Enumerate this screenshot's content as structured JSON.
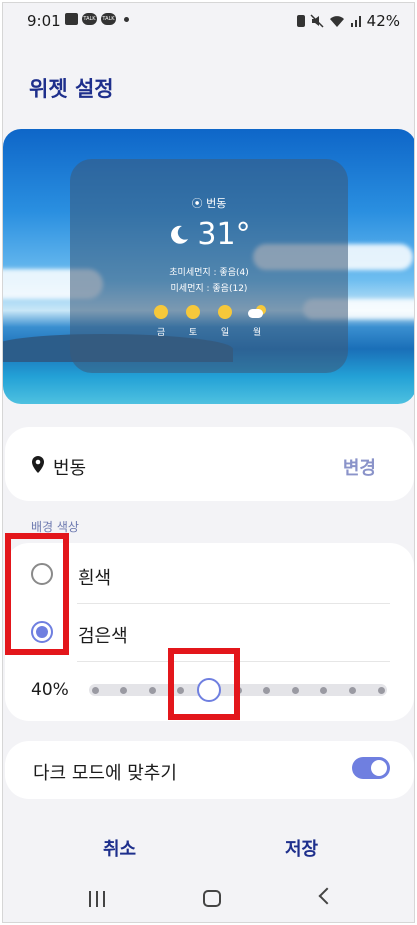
{
  "status_bar": {
    "time": "9:01",
    "notification_icons": [
      "image-icon",
      "talk-icon",
      "talk-icon",
      "dot-icon"
    ],
    "talk_label": "TALK",
    "battery": "42%",
    "status_icons": [
      "battery-saver-icon",
      "mute-icon",
      "wifi-icon",
      "signal-icon"
    ]
  },
  "page": {
    "title": "위젯 설정"
  },
  "preview": {
    "location": "번동",
    "temperature": "31°",
    "weather_icon": "moon-icon",
    "fine_dust": "초미세먼지 : 좋음(4)",
    "dust": "미세먼지 : 좋음(12)",
    "forecast": [
      {
        "day": "금",
        "icon": "sun-icon"
      },
      {
        "day": "토",
        "icon": "sun-icon"
      },
      {
        "day": "일",
        "icon": "sun-icon"
      },
      {
        "day": "월",
        "icon": "cloud-sun-icon"
      }
    ]
  },
  "location_card": {
    "name": "번동",
    "change_label": "변경"
  },
  "background": {
    "section_label": "배경 색상",
    "options": [
      {
        "label": "흰색",
        "checked": false
      },
      {
        "label": "검은색",
        "checked": true
      }
    ],
    "transparency_label": "40%",
    "slider": {
      "steps": 11,
      "selected_index": 4
    }
  },
  "dark_mode": {
    "label": "다크 모드에 맞추기",
    "enabled": true
  },
  "actions": {
    "cancel": "취소",
    "save": "저장"
  },
  "colors": {
    "accent": "#6f7fe0",
    "title": "#1e2f8c",
    "highlight": "#e3161b"
  }
}
